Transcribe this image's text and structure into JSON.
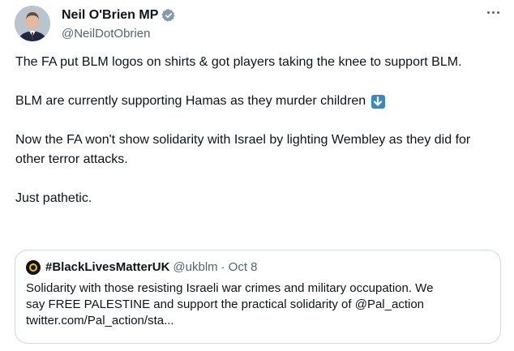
{
  "author": {
    "name": "Neil O'Brien MP",
    "handle": "@NeilDotObrien"
  },
  "tweet": {
    "paragraphs": [
      "The FA put BLM logos on shirts & got players taking the knee to support BLM.",
      "BLM are currently supporting Hamas as they murder children",
      "Now the FA won't show solidarity with Israel by lighting Wembley as they did for other terror attacks.",
      "Just pathetic."
    ]
  },
  "quoted": {
    "name": "#BlackLivesMatterUK",
    "handle": "@ukblm",
    "separator": "·",
    "date": "Oct 8",
    "text_lines": [
      "Solidarity with those resisting Israeli war crimes and military occupation. We",
      "say FREE PALESTINE and support the practical solidarity of @Pal_action",
      "twitter.com/Pal_action/sta..."
    ]
  },
  "colors": {
    "verified_badge": "#829aab",
    "secondary_text": "#536471",
    "emoji_arrow_bg": "#3b88c3",
    "quote_border": "#cfd9de"
  },
  "icons": {
    "verified": "verified-badge-icon",
    "more": "more-options-icon",
    "arrow": "down-arrow-emoji-icon"
  }
}
